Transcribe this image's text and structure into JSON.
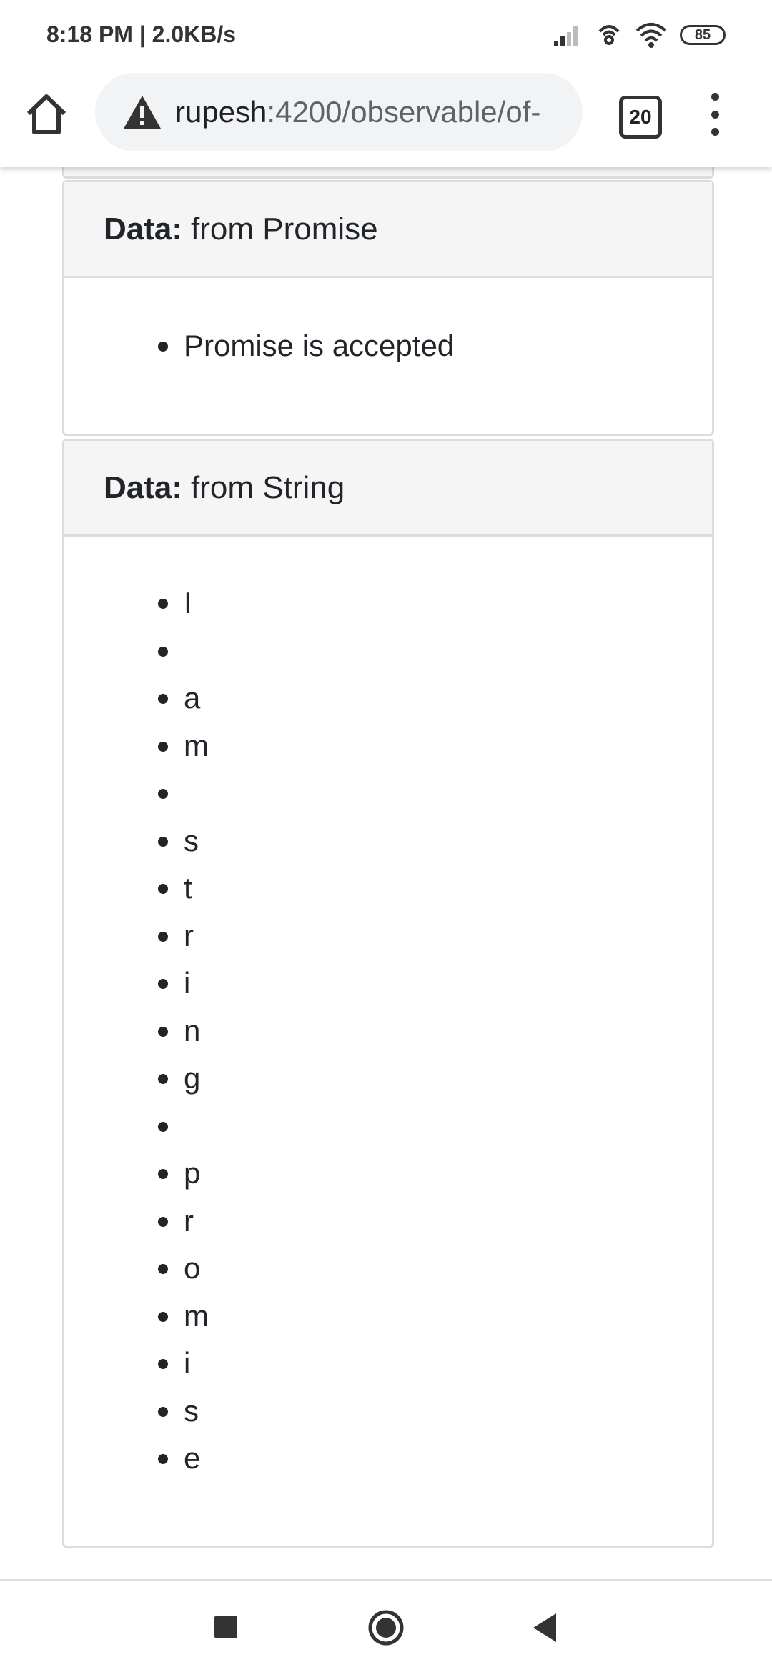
{
  "status": {
    "time": "8:18 PM | 2.0KB/s",
    "battery": "85"
  },
  "browser": {
    "url_host": "rupesh",
    "url_path": ":4200/observable/of-",
    "tab_count": "20"
  },
  "cards": [
    {
      "label": "Data:",
      "title": "from Promise",
      "items": [
        "Promise is accepted"
      ]
    },
    {
      "label": "Data:",
      "title": "from String",
      "items": [
        "I",
        " ",
        "a",
        "m",
        " ",
        "s",
        "t",
        "r",
        "i",
        "n",
        "g",
        " ",
        "p",
        "r",
        "o",
        "m",
        "i",
        "s",
        "e"
      ]
    }
  ],
  "icons": {
    "home": "home-icon",
    "warning": "warning-icon",
    "menu": "more-vert-icon",
    "recents": "recents-icon",
    "nav_home": "nav-home-icon",
    "back": "back-icon"
  }
}
